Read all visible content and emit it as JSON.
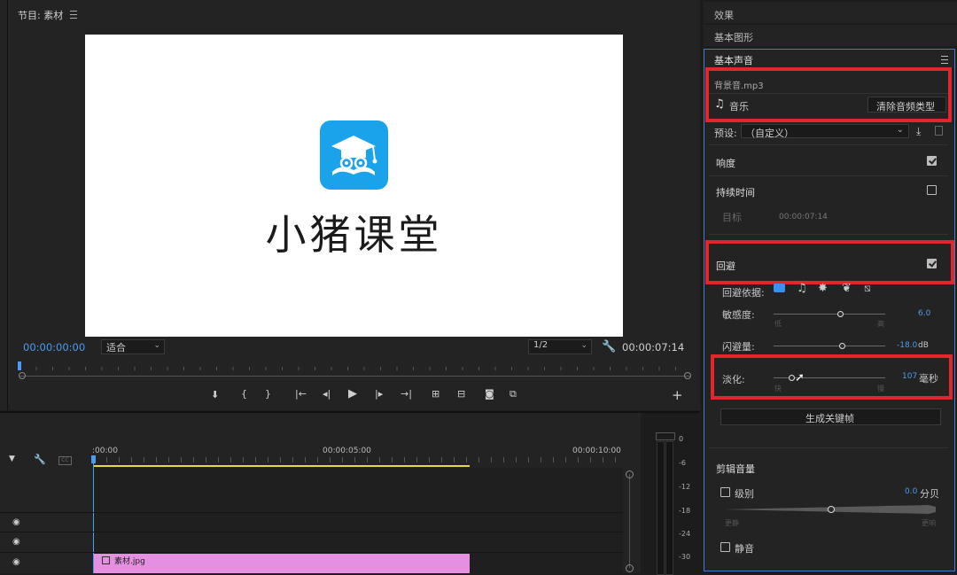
{
  "program_monitor": {
    "title": "节目: 素材",
    "menu_icon": "hamburger-icon",
    "logo_text": "小猪课堂",
    "timecode_current": "00:00:00:00",
    "fit_value": "适合",
    "resolution_value": "1/2",
    "timecode_duration": "00:00:07:14"
  },
  "timeline": {
    "ruler_labels": [
      ":00:00",
      "00:00:05:00",
      "00:00:10:00"
    ],
    "clip_name": "素材.jpg",
    "clip_color": "#e58fe0",
    "meter_scale": [
      "0",
      "-6",
      "-12",
      "-18",
      "-24",
      "-30"
    ]
  },
  "right_panel": {
    "tab_effects": "效果",
    "tab_graphics": "基本图形",
    "tab_audio": "基本声音",
    "clip_file": "背景音.mp3",
    "audio_type": "音乐",
    "clear_button": "清除音频类型",
    "preset_label": "预设:",
    "preset_value": "（自定义）",
    "loudness_label": "响度",
    "duration_label": "持续时间",
    "target_label": "目标",
    "target_value": "00:00:07:14",
    "ducking_label": "回避",
    "duck_against_label": "回避依据:",
    "sensitivity_label": "敏感度:",
    "sensitivity_value": "6.0",
    "sensitivity_low": "低",
    "sensitivity_high": "高",
    "duck_amount_label": "闪避量:",
    "duck_amount_value": "-18.0",
    "duck_amount_unit": "dB",
    "fade_label": "淡化:",
    "fade_value": "107",
    "fade_unit": "毫秒",
    "fade_low": "快",
    "fade_high": "慢",
    "generate_keyframes": "生成关键帧",
    "clip_volume_label": "剪辑音量",
    "level_label": "级别",
    "level_value": "0.0",
    "level_unit": "分贝",
    "quieter": "更静",
    "louder": "更响",
    "mute_label": "静音",
    "accent_color": "#4b9bf0",
    "highlight_color": "#e3262b"
  }
}
